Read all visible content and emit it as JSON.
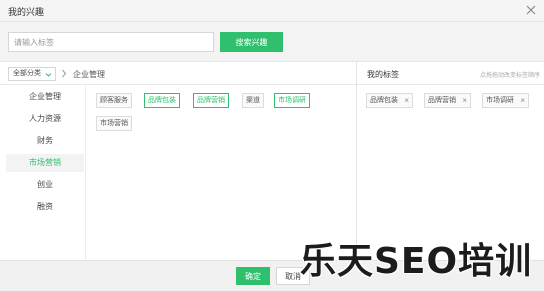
{
  "dialog": {
    "title": "我的兴趣"
  },
  "search": {
    "placeholder": "请输入标签",
    "button_label": "搜索兴趣"
  },
  "breadcrumb": {
    "category_select": "全部分类",
    "current": "企业管理"
  },
  "categories": [
    {
      "label": "企业管理",
      "active": false
    },
    {
      "label": "人力资源",
      "active": false
    },
    {
      "label": "财务",
      "active": false
    },
    {
      "label": "市场营销",
      "active": true
    },
    {
      "label": "创业",
      "active": false
    },
    {
      "label": "融资",
      "active": false
    }
  ],
  "tags": [
    {
      "label": "顾客服务",
      "selected": false
    },
    {
      "label": "品牌包装",
      "selected": true
    },
    {
      "label": "品牌营销",
      "selected": true
    },
    {
      "label": "渠道",
      "selected": false
    },
    {
      "label": "市场调研",
      "selected": true
    },
    {
      "label": "市场营销",
      "selected": false
    }
  ],
  "my_tags": {
    "title": "我的标签",
    "hint": "点拖拖动改变标签顺序",
    "items": [
      {
        "label": "品牌包装"
      },
      {
        "label": "品牌营销"
      },
      {
        "label": "市场调研"
      }
    ]
  },
  "footer": {
    "ok_label": "确定",
    "cancel_label": "取消"
  },
  "watermark": {
    "text": "乐天SEO培训"
  },
  "colors": {
    "accent": "#2fbf6d",
    "panel_bg": "#f3f3f3",
    "border": "#dcdcdc"
  },
  "icons": {
    "close": "close-icon",
    "chevron": "chevron-down-icon",
    "breadcrumb_separator": "chevron-right-icon",
    "remove": "close-icon"
  }
}
